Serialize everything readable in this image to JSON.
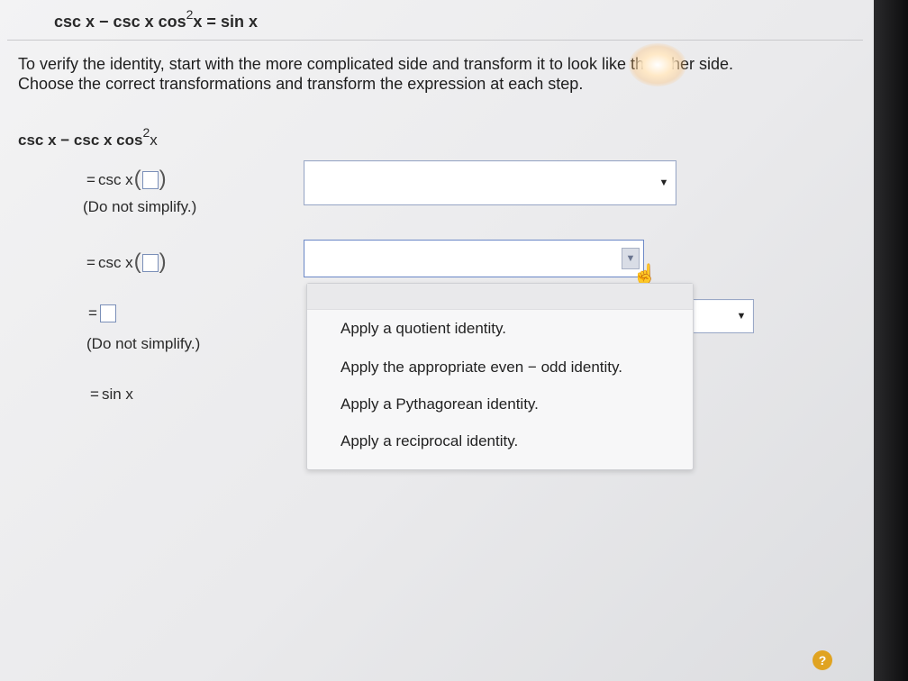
{
  "problem": {
    "lhs_part1": "csc x − csc x cos",
    "exponent": "2",
    "lhs_part2": "x = sin x"
  },
  "instructions": {
    "line1": "To verify the identity, start with the more complicated side and transform it to look like the other side.",
    "line2": "Choose the correct transformations and transform the expression at each step."
  },
  "work": {
    "start_part1": "csc x − csc x cos",
    "start_exponent": "2",
    "start_part2": "x",
    "step1": {
      "eq": "=",
      "fn": "csc x",
      "note": "(Do not simplify.)"
    },
    "step2": {
      "eq": "=",
      "fn": "csc x"
    },
    "step3": {
      "eq": "=",
      "note": "(Do not simplify.)"
    },
    "step4": {
      "eq": "=",
      "fn": "sin x"
    }
  },
  "dropdown": {
    "options": [
      "Apply a quotient identity.",
      "Apply the appropriate even − odd identity.",
      "Apply a Pythagorean identity.",
      "Apply a reciprocal identity."
    ]
  },
  "icons": {
    "arrow": "▼",
    "help": "?"
  }
}
